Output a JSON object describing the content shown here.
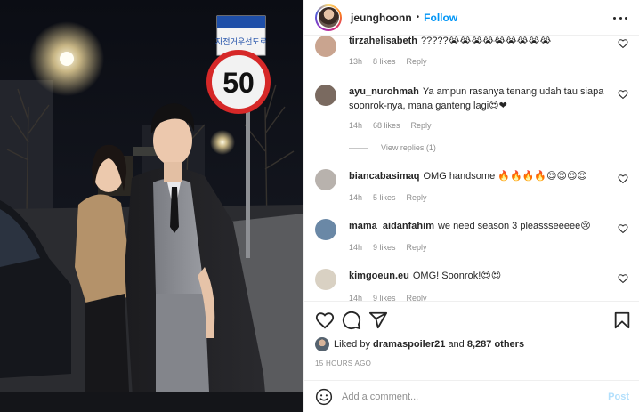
{
  "post": {
    "username": "jeunghoonn",
    "follow_label": "Follow",
    "dot": "•"
  },
  "sign": {
    "speed_limit": "50",
    "korean_text": "자전거우선도로"
  },
  "comments": [
    {
      "user": "tirzahelisabeth",
      "text": "?????😭😭😭😭😭😭😭😭😭",
      "time": "13h",
      "likes": "8 likes",
      "reply": "Reply",
      "avatar_color": "#c9a48f"
    },
    {
      "user": "ayu_nurohmah",
      "text": "Ya ampun rasanya tenang udah tau siapa soonrok-nya, mana ganteng lagi😍❤",
      "time": "14h",
      "likes": "68 likes",
      "reply": "Reply",
      "avatar_color": "#7a6a60"
    },
    {
      "user": "biancabasimaq",
      "text": "OMG handsome 🔥🔥🔥🔥😍😍😍😍",
      "time": "14h",
      "likes": "5 likes",
      "reply": "Reply",
      "avatar_color": "#b8b2ad"
    },
    {
      "user": "mama_aidanfahim",
      "text": "we need season 3 pleassseeeee😢",
      "time": "14h",
      "likes": "9 likes",
      "reply": "Reply",
      "avatar_color": "#6a88a6"
    },
    {
      "user": "kimgoeun.eu",
      "text": "OMG! Soonrok!😍😍",
      "time": "14h",
      "likes": "9 likes",
      "reply": "Reply",
      "avatar_color": "#d9d1c3"
    }
  ],
  "view_replies": "View replies (1)",
  "likes": {
    "prefix": "Liked by ",
    "user": "dramaspoiler21",
    "middle": " and ",
    "count": "8,287 others"
  },
  "timestamp": "15 HOURS AGO",
  "add_comment": {
    "placeholder": "Add a comment...",
    "post_label": "Post"
  },
  "colors": {
    "accent": "#0095f6",
    "muted": "#8e8e8e",
    "post_disabled": "#b2dffc"
  },
  "icons": [
    "heart-icon",
    "comment-icon",
    "share-icon",
    "bookmark-icon",
    "emoji-icon",
    "more-icon"
  ]
}
